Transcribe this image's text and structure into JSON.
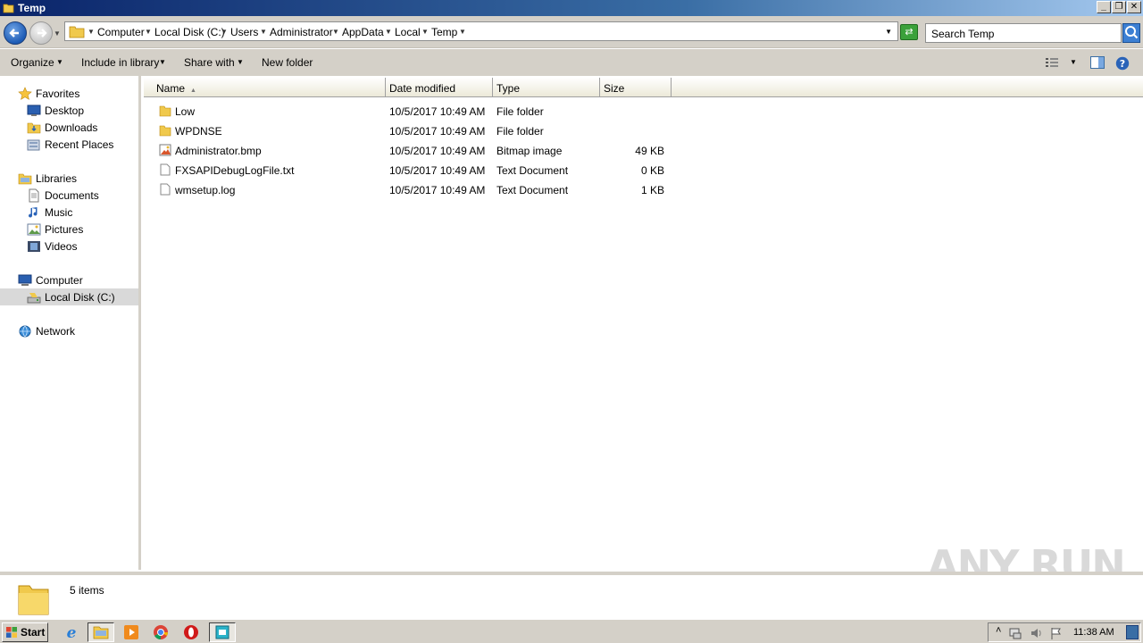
{
  "window": {
    "title": "Temp"
  },
  "address": {
    "crumbs": [
      "Computer",
      "Local Disk (C:)",
      "Users",
      "Administrator",
      "AppData",
      "Local",
      "Temp"
    ]
  },
  "search": {
    "placeholder": "Search Temp"
  },
  "toolbar": {
    "organize": "Organize",
    "include_in_library": "Include in library",
    "share_with": "Share with",
    "new_folder": "New folder"
  },
  "nav": {
    "favorites": "Favorites",
    "desktop": "Desktop",
    "downloads": "Downloads",
    "recent_places": "Recent Places",
    "libraries": "Libraries",
    "documents": "Documents",
    "music": "Music",
    "pictures": "Pictures",
    "videos": "Videos",
    "computer": "Computer",
    "local_disk": "Local Disk (C:)",
    "network": "Network"
  },
  "columns": {
    "name": "Name",
    "date": "Date modified",
    "type": "Type",
    "size": "Size"
  },
  "files": [
    {
      "name": "Low",
      "date": "10/5/2017 10:49 AM",
      "type": "File folder",
      "size": "",
      "icon": "folder-icon"
    },
    {
      "name": "WPDNSE",
      "date": "10/5/2017 10:49 AM",
      "type": "File folder",
      "size": "",
      "icon": "folder-icon"
    },
    {
      "name": "Administrator.bmp",
      "date": "10/5/2017 10:49 AM",
      "type": "Bitmap image",
      "size": "49 KB",
      "icon": "bitmap-icon"
    },
    {
      "name": "FXSAPIDebugLogFile.txt",
      "date": "10/5/2017 10:49 AM",
      "type": "Text Document",
      "size": "0 KB",
      "icon": "text-file-icon"
    },
    {
      "name": "wmsetup.log",
      "date": "10/5/2017 10:49 AM",
      "type": "Text Document",
      "size": "1 KB",
      "icon": "text-file-icon"
    }
  ],
  "status": {
    "items": "5 items"
  },
  "watermark": "ANY RUN",
  "taskbar": {
    "start": "Start",
    "clock": "11:38 AM"
  },
  "colors": {
    "title_gradient_start": "#0a246a",
    "selection": "#d9d9d9",
    "chrome": "#d4d0c8"
  }
}
